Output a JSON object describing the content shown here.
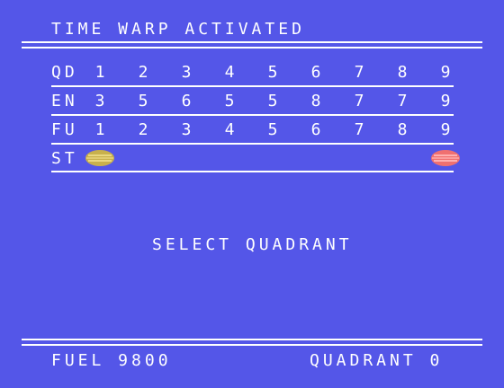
{
  "header": {
    "title": "TIME WARP ACTIVATED"
  },
  "grid": {
    "rows": [
      {
        "label": "QD",
        "values": [
          "1",
          "2",
          "3",
          "4",
          "5",
          "6",
          "7",
          "8",
          "9"
        ]
      },
      {
        "label": "EN",
        "values": [
          "3",
          "5",
          "6",
          "5",
          "5",
          "8",
          "7",
          "7",
          "9"
        ]
      },
      {
        "label": "FU",
        "values": [
          "1",
          "2",
          "3",
          "4",
          "5",
          "6",
          "7",
          "8",
          "9"
        ]
      }
    ],
    "status_row": {
      "label": "ST"
    }
  },
  "ships": [
    {
      "name": "player-ship",
      "quadrant": 1,
      "color": "#c8b04c",
      "stripe": "#e9d880"
    },
    {
      "name": "enemy-ship",
      "quadrant": 9,
      "color": "#f07070",
      "stripe": "#ffb0b0"
    }
  ],
  "prompt": "SELECT QUADRANT",
  "footer": {
    "fuel": "FUEL 9800",
    "quadrant": "QUADRANT 0"
  }
}
